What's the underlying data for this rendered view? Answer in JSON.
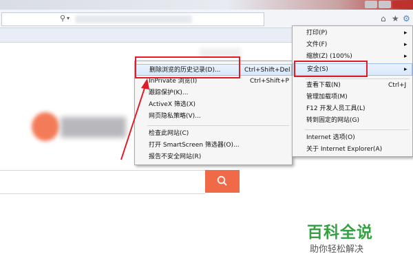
{
  "browser": {
    "nav_icons": [
      "home-icon",
      "star-icon",
      "gear-icon"
    ]
  },
  "tools_menu": {
    "items": [
      {
        "label": "打印(P)",
        "arrow": "▸"
      },
      {
        "label": "文件(F)",
        "arrow": "▸"
      },
      {
        "label": "缩放(Z) (100%)",
        "arrow": "▸"
      },
      {
        "label": "安全(S)",
        "arrow": "▸"
      },
      {
        "label": "查看下载(N)",
        "shortcut": "Ctrl+J"
      },
      {
        "label": "管理加载项(M)"
      },
      {
        "label": "F12 开发人员工具(L)"
      },
      {
        "label": "转到固定的网站(G)"
      },
      {
        "label": "Internet 选项(O)"
      },
      {
        "label": "关于 Internet Explorer(A)"
      }
    ]
  },
  "safety_menu": {
    "items": [
      {
        "label": "删除浏览的历史记录(D)...",
        "shortcut": "Ctrl+Shift+Del"
      },
      {
        "label": "InPrivate 浏览(I)",
        "shortcut": "Ctrl+Shift+P"
      },
      {
        "label": "跟踪保护(K)..."
      },
      {
        "label": "ActiveX 筛选(X)"
      },
      {
        "label": "网页隐私策略(V)..."
      },
      {
        "label": "检查此网站(C)"
      },
      {
        "label": "打开 SmartScreen 筛选器(O)..."
      },
      {
        "label": "报告不安全网站(R)"
      }
    ]
  },
  "watermark": {
    "title": "百科全说",
    "subtitle": "助你轻松解决"
  },
  "colors": {
    "annotation_red": "#e21a25",
    "search_button": "#f06a47",
    "watermark_green": "#35a142"
  }
}
